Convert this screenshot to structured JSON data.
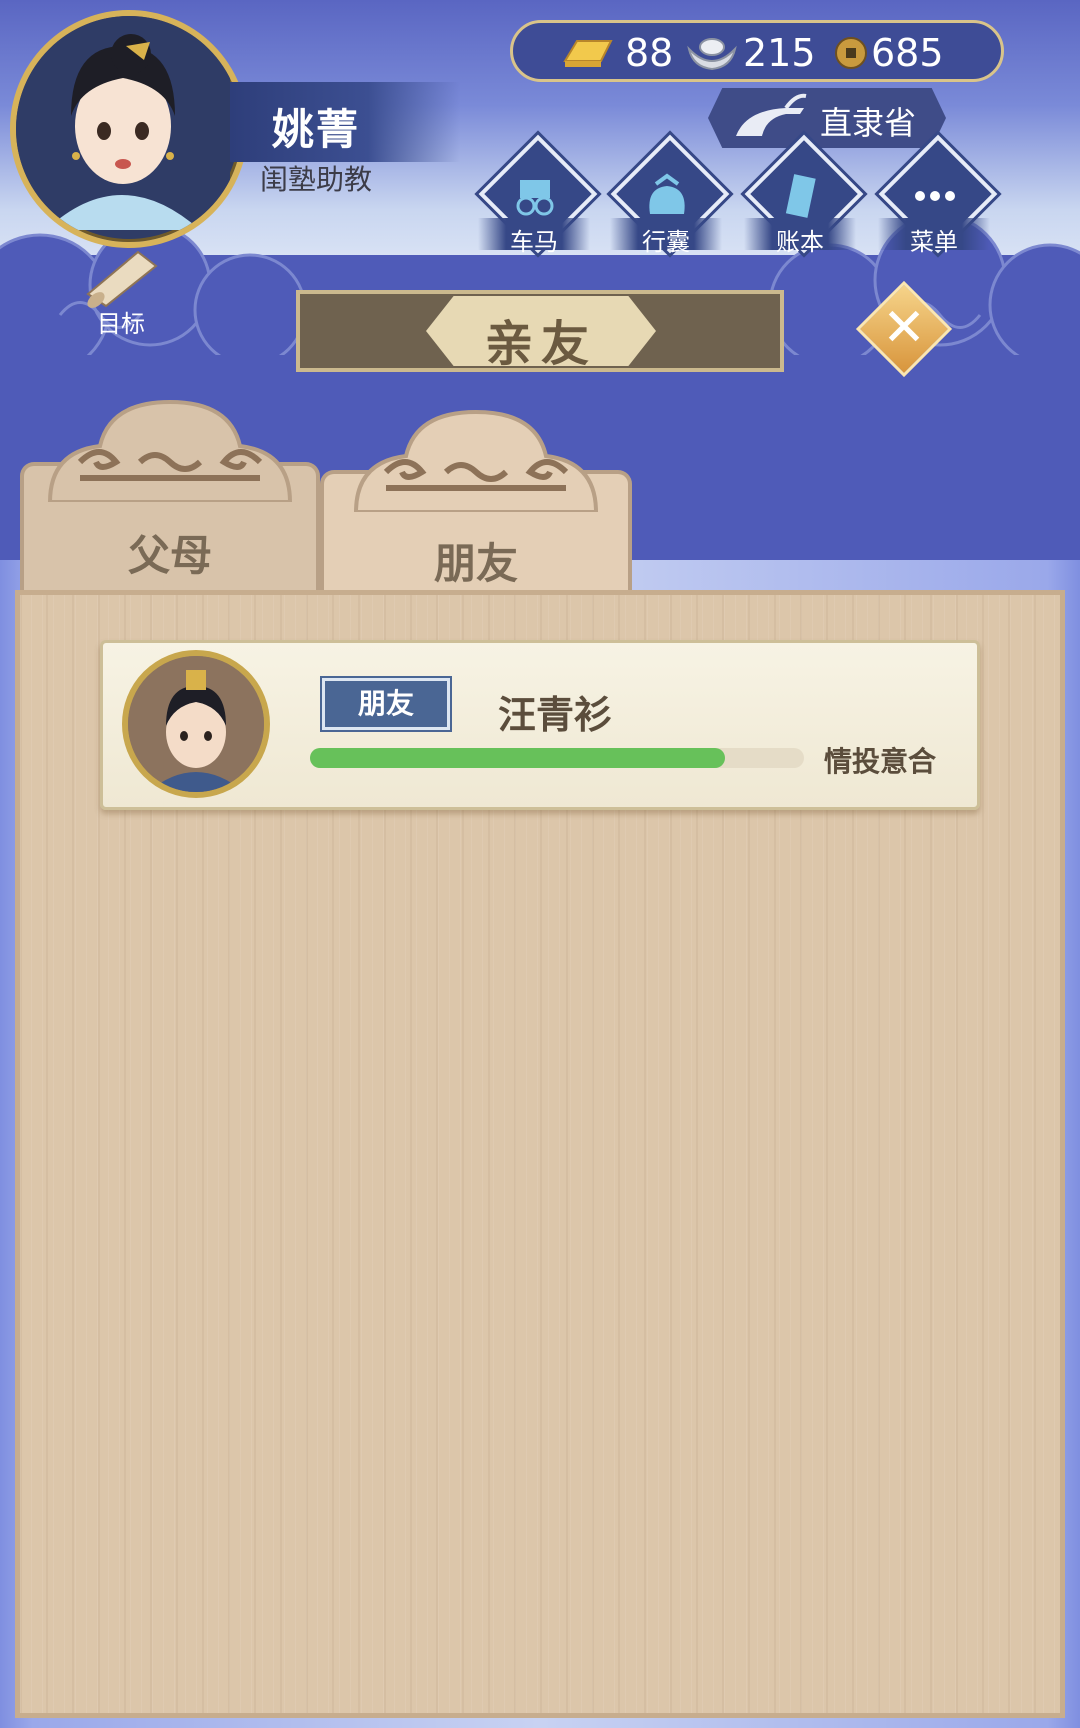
{
  "player": {
    "name": "姚菁",
    "title": "闺塾助教"
  },
  "resources": {
    "gold": "88",
    "silver": "215",
    "coins": "685"
  },
  "location": {
    "province": "直隶省"
  },
  "menu": [
    {
      "label": "车马",
      "icon": "carriage-icon"
    },
    {
      "label": "行囊",
      "icon": "bundle-icon"
    },
    {
      "label": "账本",
      "icon": "ledger-icon"
    },
    {
      "label": "菜单",
      "icon": "more-icon"
    }
  ],
  "goal": {
    "label": "目标",
    "icon": "scroll-icon"
  },
  "dialog": {
    "title": "亲友",
    "tabs": [
      {
        "label": "父母",
        "active": false
      },
      {
        "label": "朋友",
        "active": true
      }
    ]
  },
  "friends": [
    {
      "relation": "朋友",
      "name": "汪青衫",
      "bond_label": "情投意合",
      "bond_progress": 0.84
    }
  ],
  "colors": {
    "sky_blue": "#4f5bb8",
    "wood": "#dcc6aa",
    "progress_green": "#67c15a",
    "gold_accent": "#d7b35a"
  }
}
